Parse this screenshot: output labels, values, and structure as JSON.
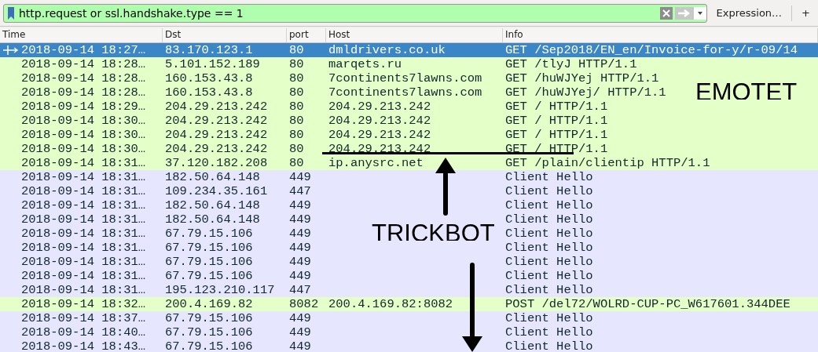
{
  "filter": {
    "value": "http.request or ssl.handshake.type == 1",
    "valid": true,
    "expression_button": "Expression…",
    "add_button": "+"
  },
  "columns": [
    "Time",
    "Dst",
    "port",
    "Host",
    "Info"
  ],
  "rows": [
    {
      "kind": "http",
      "selected": true,
      "time": "2018-09-14 18:27…",
      "dst": "83.170.123.1",
      "port": "80",
      "host": "dmldrivers.co.uk",
      "info": "GET /Sep2018/EN_en/Invoice-for-y/r-09/14"
    },
    {
      "kind": "http",
      "selected": false,
      "time": "2018-09-14 18:28…",
      "dst": "5.101.152.189",
      "port": "80",
      "host": "marqets.ru",
      "info": "GET /tlyJ HTTP/1.1"
    },
    {
      "kind": "http",
      "selected": false,
      "time": "2018-09-14 18:28…",
      "dst": "160.153.43.8",
      "port": "80",
      "host": "7continents7lawns.com",
      "info": "GET /huWJYej HTTP/1.1"
    },
    {
      "kind": "http",
      "selected": false,
      "time": "2018-09-14 18:28…",
      "dst": "160.153.43.8",
      "port": "80",
      "host": "7continents7lawns.com",
      "info": "GET /huWJYej/ HTTP/1.1"
    },
    {
      "kind": "http",
      "selected": false,
      "time": "2018-09-14 18:29…",
      "dst": "204.29.213.242",
      "port": "80",
      "host": "204.29.213.242",
      "info": "GET / HTTP/1.1"
    },
    {
      "kind": "http",
      "selected": false,
      "time": "2018-09-14 18:30…",
      "dst": "204.29.213.242",
      "port": "80",
      "host": "204.29.213.242",
      "info": "GET / HTTP/1.1"
    },
    {
      "kind": "http",
      "selected": false,
      "time": "2018-09-14 18:30…",
      "dst": "204.29.213.242",
      "port": "80",
      "host": "204.29.213.242",
      "info": "GET / HTTP/1.1"
    },
    {
      "kind": "http",
      "selected": false,
      "time": "2018-09-14 18:30…",
      "dst": "204.29.213.242",
      "port": "80",
      "host": "204.29.213.242",
      "info": "GET / HTTP/1.1"
    },
    {
      "kind": "http",
      "selected": false,
      "time": "2018-09-14 18:31…",
      "dst": "37.120.182.208",
      "port": "80",
      "host": "ip.anysrc.net",
      "info": "GET /plain/clientip HTTP/1.1"
    },
    {
      "kind": "tls",
      "selected": false,
      "time": "2018-09-14 18:31…",
      "dst": "182.50.64.148",
      "port": "449",
      "info": "Client Hello"
    },
    {
      "kind": "tls",
      "selected": false,
      "time": "2018-09-14 18:31…",
      "dst": "109.234.35.161",
      "port": "447",
      "info": "Client Hello"
    },
    {
      "kind": "tls",
      "selected": false,
      "time": "2018-09-14 18:31…",
      "dst": "182.50.64.148",
      "port": "449",
      "info": "Client Hello"
    },
    {
      "kind": "tls",
      "selected": false,
      "time": "2018-09-14 18:31…",
      "dst": "182.50.64.148",
      "port": "449",
      "info": "Client Hello"
    },
    {
      "kind": "tls",
      "selected": false,
      "time": "2018-09-14 18:31…",
      "dst": "67.79.15.106",
      "port": "449",
      "info": "Client Hello"
    },
    {
      "kind": "tls",
      "selected": false,
      "time": "2018-09-14 18:31…",
      "dst": "67.79.15.106",
      "port": "449",
      "info": "Client Hello"
    },
    {
      "kind": "tls",
      "selected": false,
      "time": "2018-09-14 18:31…",
      "dst": "67.79.15.106",
      "port": "449",
      "info": "Client Hello"
    },
    {
      "kind": "tls",
      "selected": false,
      "time": "2018-09-14 18:31…",
      "dst": "67.79.15.106",
      "port": "449",
      "info": "Client Hello"
    },
    {
      "kind": "tls",
      "selected": false,
      "time": "2018-09-14 18:31…",
      "dst": "195.123.210.117",
      "port": "447",
      "info": "Client Hello"
    },
    {
      "kind": "http",
      "selected": false,
      "time": "2018-09-14 18:32…",
      "dst": "200.4.169.82",
      "port": "8082",
      "host": "200.4.169.82:8082",
      "info": "POST /del72/WOLRD-CUP-PC_W617601.344DEE"
    },
    {
      "kind": "tls",
      "selected": false,
      "time": "2018-09-14 18:37…",
      "dst": "67.79.15.106",
      "port": "449",
      "info": "Client Hello"
    },
    {
      "kind": "tls",
      "selected": false,
      "time": "2018-09-14 18:40…",
      "dst": "67.79.15.106",
      "port": "449",
      "info": "Client Hello"
    },
    {
      "kind": "tls",
      "selected": false,
      "time": "2018-09-14 18:43…",
      "dst": "67.79.15.106",
      "port": "449",
      "info": "Client Hello"
    }
  ],
  "annotations": [
    {
      "kind": "label",
      "text": "EMOTET"
    },
    {
      "kind": "label",
      "text": "TRICKBOT"
    }
  ]
}
